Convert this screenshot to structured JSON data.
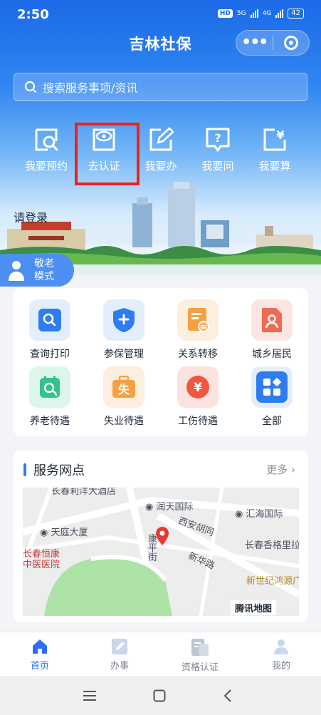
{
  "status": {
    "time": "2:50",
    "hd": "HD",
    "network": "5G",
    "network2": "4G",
    "battery": "42"
  },
  "header": {
    "title": "吉林社保"
  },
  "search": {
    "placeholder": "搜索服务事项/资讯"
  },
  "quick_actions": [
    {
      "label": "我要预约",
      "icon": "calendar-search-icon"
    },
    {
      "label": "去认证",
      "icon": "eye-icon",
      "highlighted": true
    },
    {
      "label": "我要办",
      "icon": "edit-icon"
    },
    {
      "label": "我要问",
      "icon": "question-icon"
    },
    {
      "label": "我要算",
      "icon": "yuan-document-icon"
    }
  ],
  "login": {
    "label": "请登录"
  },
  "elder_mode": {
    "line1": "敬老",
    "line2": "模式"
  },
  "services": [
    {
      "label": "查询打印",
      "icon": "search-icon",
      "color": "#2f7cf0"
    },
    {
      "label": "参保管理",
      "icon": "shield-plus-icon",
      "color": "#2f7cf0"
    },
    {
      "label": "关系转移",
      "icon": "transfer-document-icon",
      "color": "#f5a142"
    },
    {
      "label": "城乡居民",
      "icon": "resident-icon",
      "color": "#f06b55"
    },
    {
      "label": "养老待遇",
      "icon": "pension-icon",
      "color": "#33c28c"
    },
    {
      "label": "失业待遇",
      "icon": "unemployment-icon",
      "color": "#f5a142"
    },
    {
      "label": "工伤待遇",
      "icon": "injury-yuan-icon",
      "color": "#f0553f"
    },
    {
      "label": "全部",
      "icon": "grid-icon",
      "color": "#2f7cf0"
    }
  ],
  "service_outlets": {
    "title": "服务网点",
    "more": "更多",
    "map_labels": {
      "top": "长春莉洋大酒店",
      "runtian": "润天国际",
      "huihai": "汇海国际",
      "tianting": "天庭大厦",
      "xianhu": "西安胡同",
      "kangping": "康平街",
      "changchun_xiang": "长春香格里拉",
      "hengkang": "长春恒康中医医院",
      "xinhua": "新华路",
      "xinshiji": "新世纪鸿源广场",
      "tencent": "腾讯地图"
    }
  },
  "tabbar": [
    {
      "label": "首页",
      "icon": "home-icon",
      "active": true
    },
    {
      "label": "办事",
      "icon": "pencil-square-icon",
      "active": false
    },
    {
      "label": "资格认证",
      "icon": "id-card-icon",
      "active": false
    },
    {
      "label": "我的",
      "icon": "user-icon",
      "active": false
    }
  ]
}
